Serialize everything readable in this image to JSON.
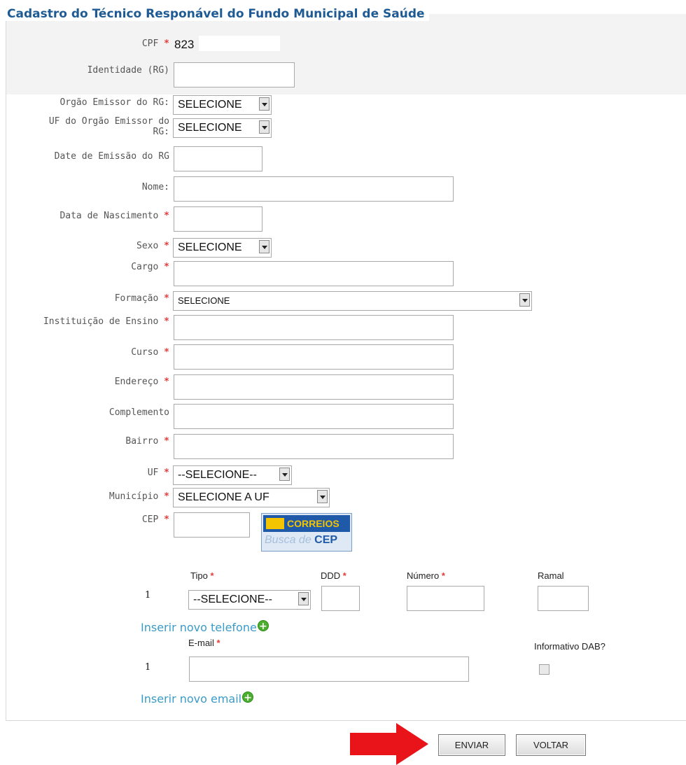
{
  "form": {
    "legend": "Cadastro do Técnico Responável do Fundo Municipal de Saúde",
    "required_marker": "*",
    "cpf": {
      "label": "CPF",
      "value": "823"
    },
    "identidade": {
      "label": "Identidade (RG)",
      "value": ""
    },
    "orgao_emissor": {
      "label": "Orgão Emissor do RG:",
      "selected": "SELECIONE"
    },
    "uf_orgao": {
      "label_line1": "UF do Orgão Emissor do",
      "label_line2": "RG:",
      "selected": "SELECIONE"
    },
    "data_emissao": {
      "label": "Date de Emissão do RG",
      "value": ""
    },
    "nome": {
      "label": "Nome:",
      "value": ""
    },
    "data_nascimento": {
      "label": "Data de Nascimento",
      "value": ""
    },
    "sexo": {
      "label": "Sexo",
      "selected": "SELECIONE"
    },
    "cargo": {
      "label": "Cargo",
      "value": ""
    },
    "formacao": {
      "label": "Formação",
      "selected": "SELECIONE"
    },
    "instituicao": {
      "label": "Instituição de Ensino",
      "value": ""
    },
    "curso": {
      "label": "Curso",
      "value": ""
    },
    "endereco": {
      "label": "Endereço",
      "value": ""
    },
    "complemento": {
      "label": "Complemento",
      "value": ""
    },
    "bairro": {
      "label": "Bairro",
      "value": ""
    },
    "uf": {
      "label": "UF",
      "selected": "--SELECIONE--"
    },
    "municipio": {
      "label": "Município",
      "selected": "SELECIONE A UF"
    },
    "cep": {
      "label": "CEP",
      "value": ""
    },
    "correios": {
      "brand": "CORREIOS",
      "busca": "Busca de",
      "cep": "CEP"
    }
  },
  "telefone": {
    "headers": {
      "tipo": "Tipo",
      "ddd": "DDD",
      "numero": "Número",
      "ramal": "Ramal"
    },
    "row_number": "1",
    "tipo_selected": "--SELECIONE--",
    "insert_link": "Inserir novo telefone"
  },
  "email": {
    "header": "E-mail",
    "informativo_header": "Informativo DAB?",
    "row_number": "1",
    "value": "",
    "informativo_checked": false,
    "insert_link": "Inserir novo email"
  },
  "buttons": {
    "enviar": "ENVIAR",
    "voltar": "VOLTAR"
  },
  "colors": {
    "legend": "#1e5a93",
    "required": "#e53b3b",
    "link": "#3a9bc7",
    "arrow": "#e8141a"
  }
}
